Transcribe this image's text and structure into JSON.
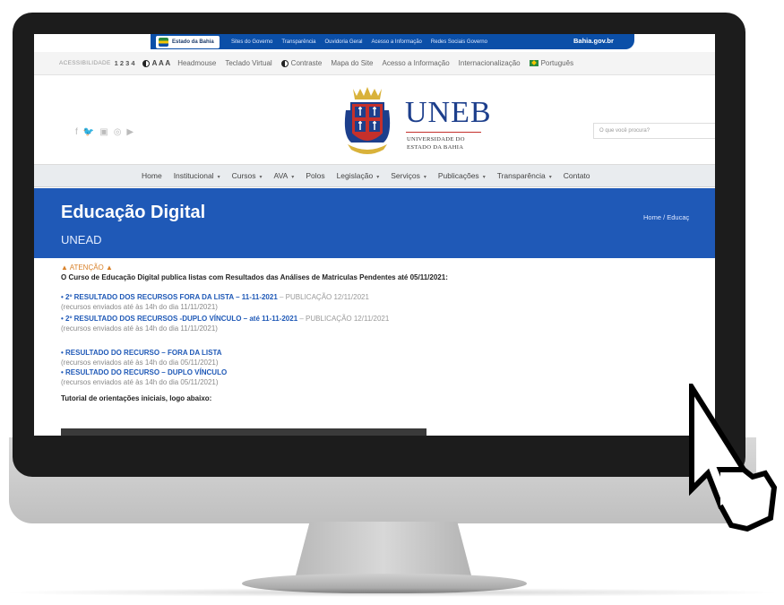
{
  "gov_bar": {
    "logo_text": "Estado da Bahia",
    "links": [
      "Sites do Governo",
      "Transparência",
      "Ouvidoria Geral",
      "Acesso a Informação",
      "Redes Sociais Governo"
    ],
    "site": "Bahia.gov.br"
  },
  "access_bar": {
    "label": "ACESSIBILIDADE",
    "shortcuts": "1 2 3 4",
    "font_controls": "A A A",
    "items": [
      "Headmouse",
      "Teclado Virtual",
      "Contraste",
      "Mapa do Site",
      "Acesso a Informação",
      "Internacionalização",
      "Português"
    ]
  },
  "header": {
    "social": [
      "f",
      "🐦",
      "▣",
      "◎",
      "▶"
    ],
    "logo_title": "UNEB",
    "logo_sub_1": "UNIVERSIDADE DO",
    "logo_sub_2": "ESTADO DA BAHIA",
    "search_placeholder": "O que você procura?"
  },
  "nav": {
    "items": [
      {
        "label": "Home",
        "dropdown": false
      },
      {
        "label": "Institucional",
        "dropdown": true
      },
      {
        "label": "Cursos",
        "dropdown": true
      },
      {
        "label": "AVA",
        "dropdown": true
      },
      {
        "label": "Polos",
        "dropdown": false
      },
      {
        "label": "Legislação",
        "dropdown": true
      },
      {
        "label": "Serviços",
        "dropdown": true
      },
      {
        "label": "Publicações",
        "dropdown": true
      },
      {
        "label": "Transparência",
        "dropdown": true
      },
      {
        "label": "Contato",
        "dropdown": false
      }
    ]
  },
  "banner": {
    "title": "Educação Digital",
    "subtitle": "UNEAD",
    "breadcrumb": "Home  /  Educaç"
  },
  "content": {
    "attention": "ATENÇÃO",
    "intro": "O Curso de Educação Digital publica listas com Resultados das Análises de Matriculas Pendentes até 05/11/2021:",
    "results": [
      {
        "link": "• 2º RESULTADO DOS RECURSOS FORA DA LISTA – 11-11-2021",
        "suffix": " – PUBLICAÇÃO 12/11/2021",
        "note": "(recursos enviados até às 14h do dia 11/11/2021)"
      },
      {
        "link": "• 2º RESULTADO DOS RECURSOS -DUPLO VÍNCULO – até 11-11-2021",
        "suffix": " – PUBLICAÇÃO 12/11/2021",
        "note": "(recursos enviados até às 14h do dia 11/11/2021)"
      },
      {
        "link": "• RESULTADO DO RECURSO – FORA DA LISTA",
        "suffix": "",
        "note": "(recursos enviados até às 14h do dia 05/11/2021)"
      },
      {
        "link": "• RESULTADO DO RECURSO – DUPLO VÍNCULO",
        "suffix": "",
        "note": "(recursos enviados até às 14h do dia 05/11/2021)"
      }
    ],
    "tutorial": "Tutorial de orientações iniciais, logo abaixo:"
  },
  "colors": {
    "brand_blue": "#1f59b7",
    "gov_blue": "#0b4fa8",
    "warning": "#d9822b"
  }
}
